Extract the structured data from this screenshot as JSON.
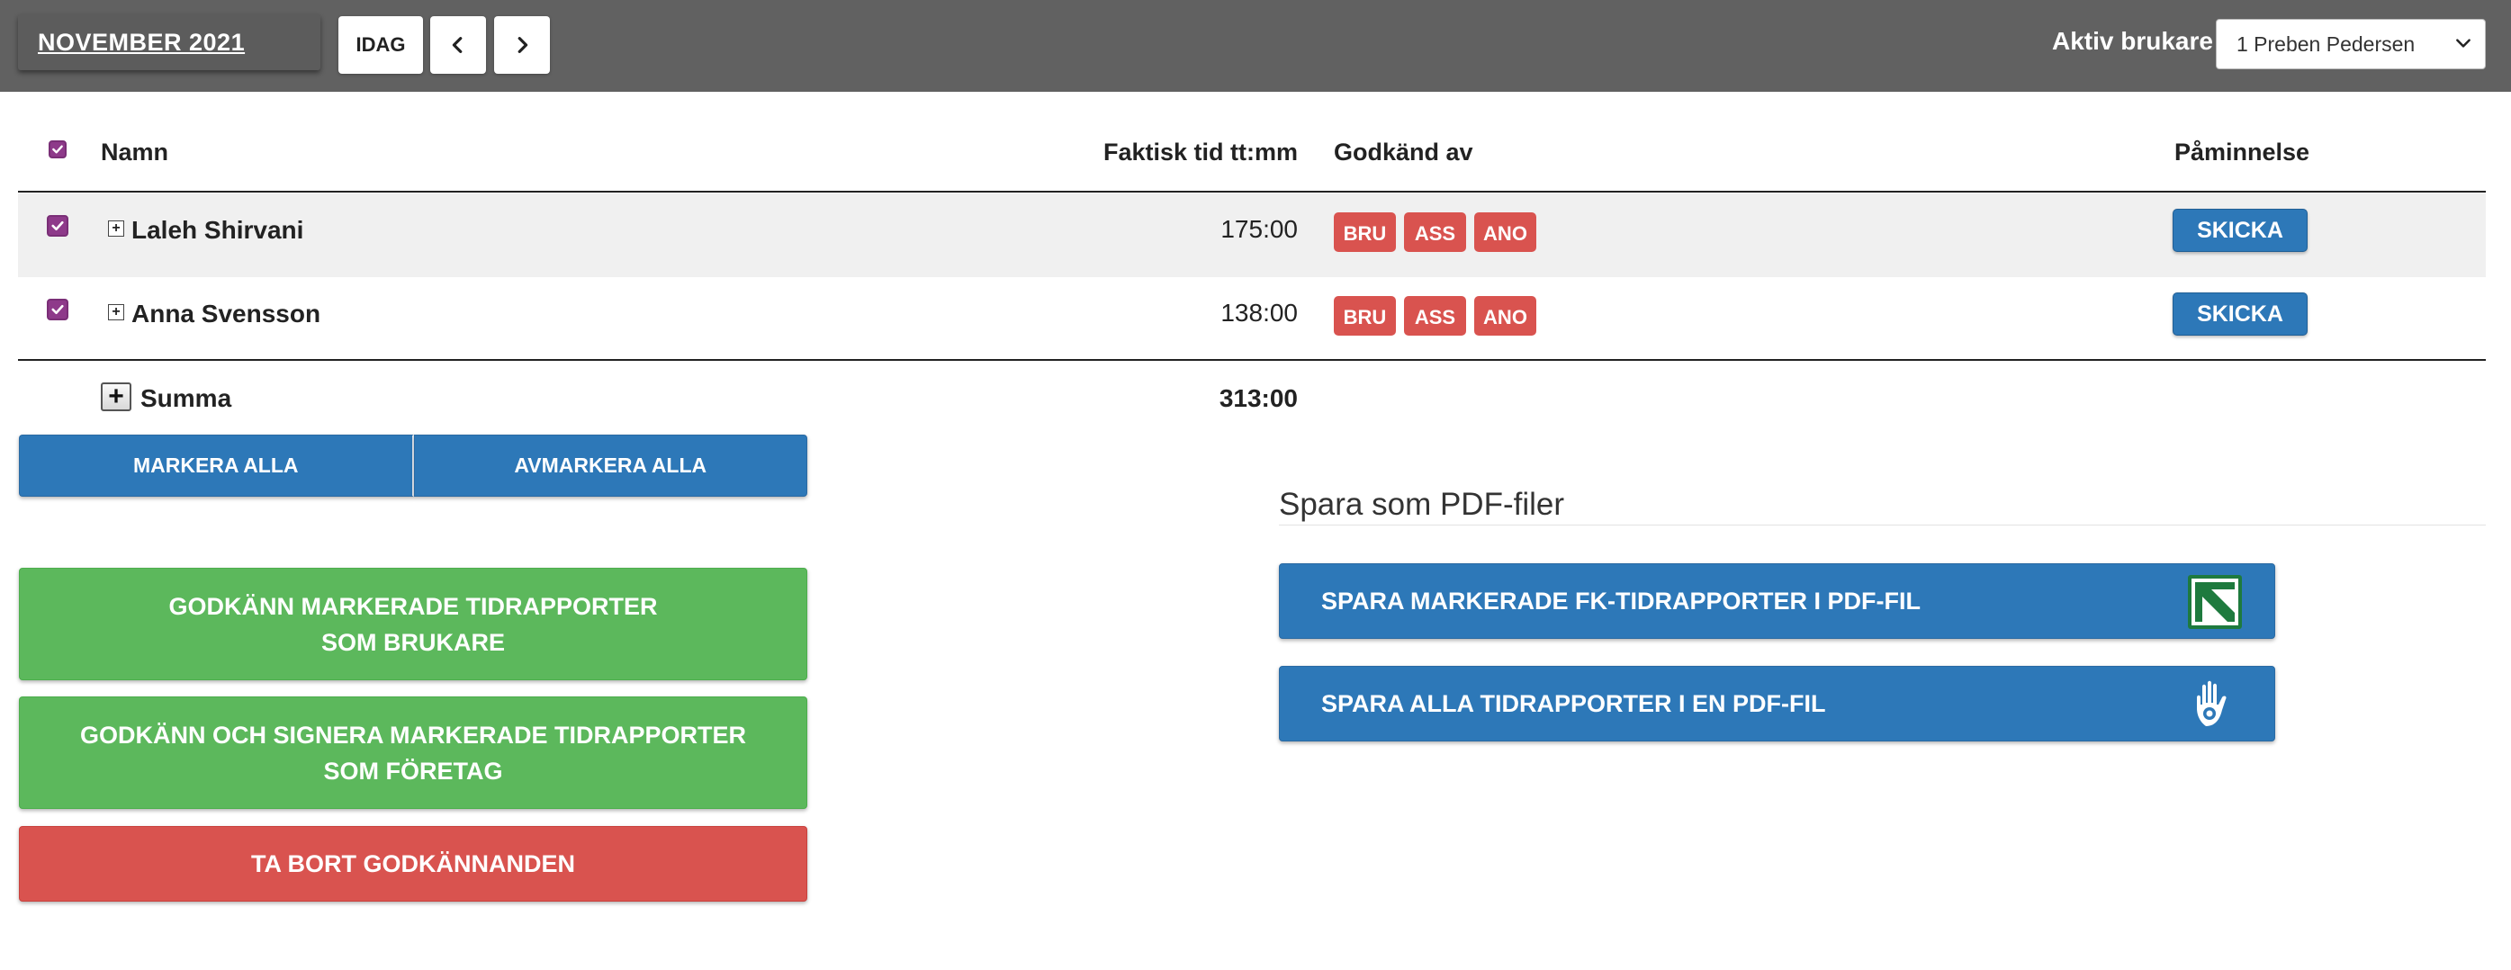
{
  "header": {
    "month_label": "NOVEMBER 2021",
    "today_label": "IDAG",
    "active_user_label": "Aktiv brukare",
    "active_user_value": "1 Preben Pedersen"
  },
  "table": {
    "columns": {
      "name": "Namn",
      "time": "Faktisk tid tt:mm",
      "approved_by": "Godkänd av",
      "reminder": "Påminnelse"
    },
    "rows": [
      {
        "name": "Laleh Shirvani",
        "time": "175:00",
        "badges": [
          "BRU",
          "ASS",
          "ANO"
        ],
        "reminder": "SKICKA"
      },
      {
        "name": "Anna Svensson",
        "time": "138:00",
        "badges": [
          "BRU",
          "ASS",
          "ANO"
        ],
        "reminder": "SKICKA"
      }
    ],
    "total_label": "Summa",
    "total_value": "313:00"
  },
  "buttons": {
    "mark_all": "MARKERA ALLA",
    "unmark_all": "AVMARKERA ALLA",
    "approve_user_line1": "GODKÄNN MARKERADE TIDRAPPORTER",
    "approve_user_line2_prefix": "SOM ",
    "approve_user_line2_bold": "BRUKARE",
    "approve_company_line1": "GODKÄNN OCH SIGNERA MARKERADE TIDRAPPORTER",
    "approve_company_line2_prefix": "SOM ",
    "approve_company_line2_bold": "FÖRETAG",
    "remove_approvals": "TA BORT GODKÄNNANDEN"
  },
  "pdf": {
    "title": "Spara som PDF-filer",
    "save_marked_fk": "SPARA MARKERADE FK-TIDRAPPORTER I PDF-FIL",
    "save_all": "SPARA ALLA TIDRAPPORTER I EN PDF-FIL"
  },
  "colors": {
    "topbar": "#616161",
    "primary_blue": "#2d78b8",
    "success_green": "#5cb85c",
    "danger_red": "#d9534f",
    "checkbox_purple": "#8e3a8a"
  },
  "icons": {
    "prev": "chevron-left-icon",
    "next": "chevron-right-icon",
    "select": "chevron-down-icon",
    "fk_logo": "fk-logo-icon",
    "hand": "hand-eye-icon"
  }
}
